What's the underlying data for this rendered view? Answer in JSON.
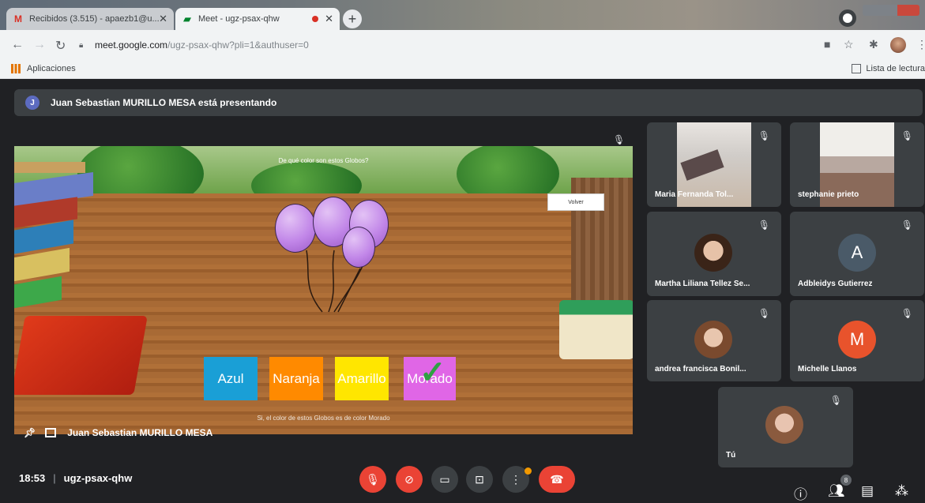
{
  "browser": {
    "tabs": [
      {
        "title": "Recibidos (3.515) - apaezb1@u...",
        "icon": "gmail-icon",
        "active": false
      },
      {
        "title": "Meet - ugz-psax-qhw",
        "icon": "meet-icon",
        "active": true
      }
    ],
    "url_host": "meet.google.com",
    "url_path": "/ugz-psax-qhw?pli=1&authuser=0",
    "bookmarks_apps": "Aplicaciones",
    "reading_list": "Lista de lectura"
  },
  "meet": {
    "presenting_banner": "Juan Sebastian MURILLO MESA está presentando",
    "presenter_initial": "J",
    "presenter_name": "Juan Sebastian MURILLO MESA",
    "presentation": {
      "question": "De qué color son estos Globos?",
      "back_button": "Volver",
      "answers": [
        "Azul",
        "Naranja",
        "Amarillo",
        "Morado"
      ],
      "answer_colors": [
        "#1a9fd6",
        "#ff8a00",
        "#ffe600",
        "#e066e6"
      ],
      "correct_answer": "Morado",
      "feedback": "Si, el color de estos Globos es de color Morado"
    },
    "participants": [
      {
        "name": "Maria Fernanda Tol...",
        "type": "video"
      },
      {
        "name": "stephanie prieto",
        "type": "video"
      },
      {
        "name": "Martha Liliana Tellez Se...",
        "type": "photo"
      },
      {
        "name": "Adbleidys Gutierrez",
        "type": "initial",
        "initial": "A",
        "color": "#4a5a68"
      },
      {
        "name": "andrea francisca Bonil...",
        "type": "photo"
      },
      {
        "name": "Michelle Llanos",
        "type": "initial",
        "initial": "M",
        "color": "#e8532c"
      },
      {
        "name": "Tú",
        "type": "photo"
      }
    ],
    "time": "18:53",
    "meeting_code": "ugz-psax-qhw",
    "people_count": "8"
  }
}
